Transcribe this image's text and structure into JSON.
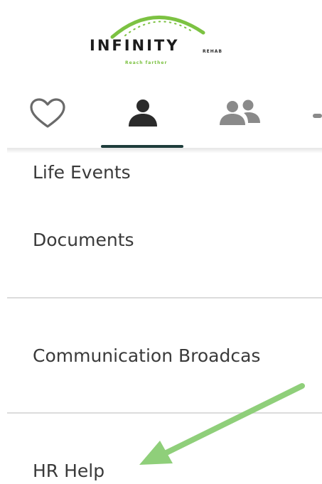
{
  "logo": {
    "wordmark": "INFINITY",
    "subtitle": "REHAB",
    "tagline": "Reach farther",
    "brand_green": "#7cc242"
  },
  "tabs": [
    {
      "name": "favorites",
      "icon": "heart-outline-icon",
      "active": false
    },
    {
      "name": "me",
      "icon": "person-icon",
      "active": true
    },
    {
      "name": "team",
      "icon": "people-icon",
      "active": false
    },
    {
      "name": "more",
      "icon": "partial-tab-icon",
      "active": false
    }
  ],
  "menu": {
    "items": [
      {
        "label": "Life Events"
      },
      {
        "label": "Documents"
      },
      {
        "label": "Communication Broadcas"
      },
      {
        "label": "HR Help"
      }
    ]
  },
  "colors": {
    "active_underline": "#1e3d3b",
    "icon_active": "#2b2b2b",
    "icon_inactive": "#8a8a8a",
    "annotation_arrow": "#8fcf7a",
    "divider": "#dcdcdc"
  }
}
